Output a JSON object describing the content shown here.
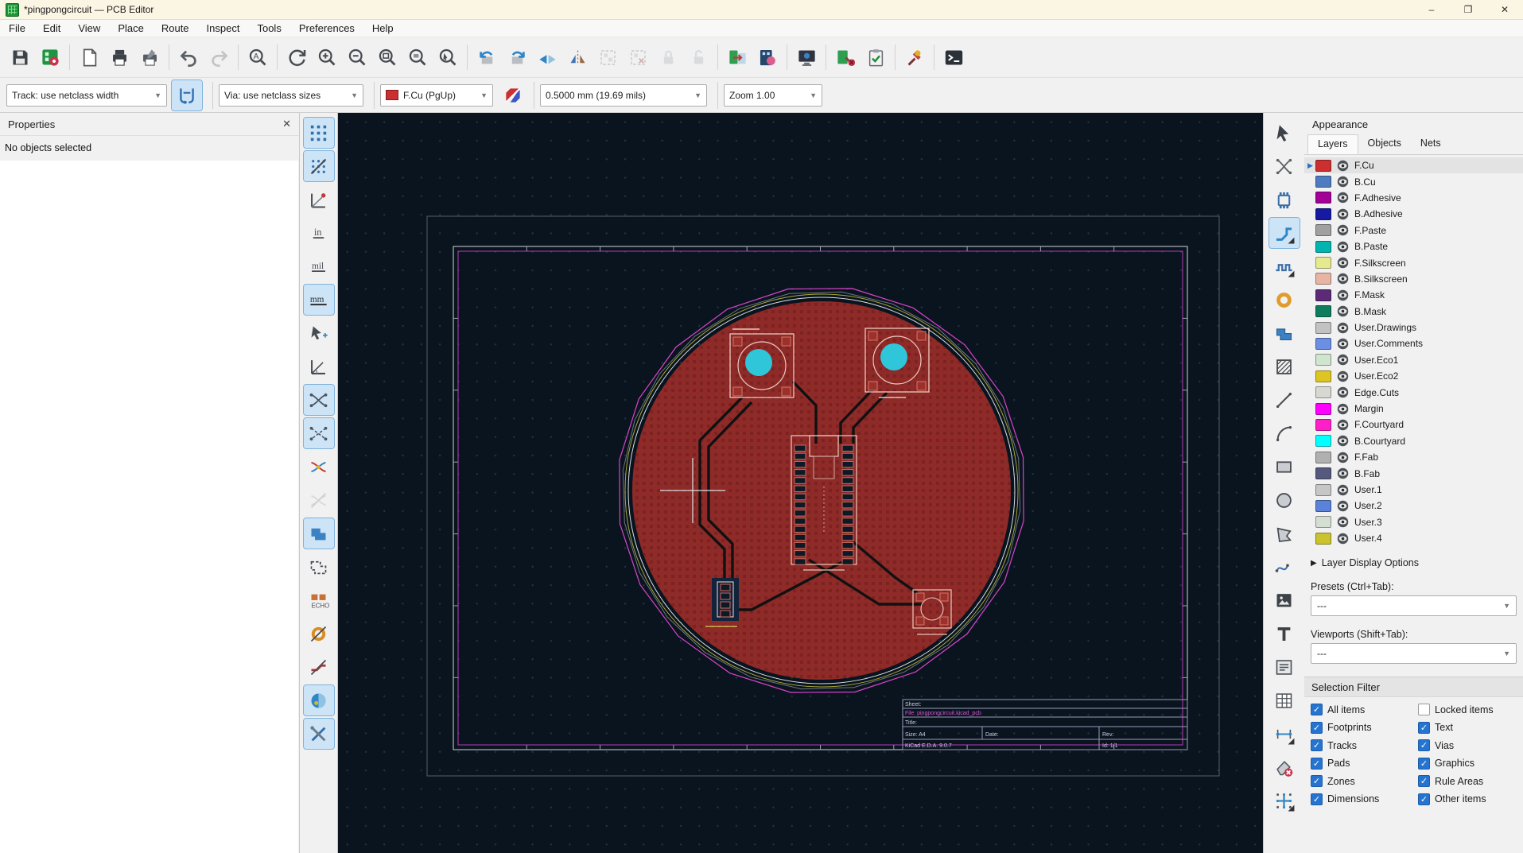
{
  "window": {
    "title": "*pingpongcircuit — PCB Editor",
    "controls": {
      "minimize": "–",
      "maximize": "❐",
      "close": "✕"
    }
  },
  "menu": {
    "items": [
      "File",
      "Edit",
      "View",
      "Place",
      "Route",
      "Inspect",
      "Tools",
      "Preferences",
      "Help"
    ]
  },
  "main_toolbar": [
    "save",
    "board-setup",
    "|",
    "page-settings",
    "print",
    "plot",
    "|",
    "undo",
    "redo:d",
    "|",
    "search",
    "|",
    "refresh-view",
    "zoom-in",
    "zoom-out",
    "zoom-fit-page",
    "zoom-fit-objects",
    "zoom-selection",
    "|",
    "rotate-ccw",
    "rotate-cw",
    "flip-board-view",
    "mirror",
    "group:d",
    "ungroup:d",
    "lock:d",
    "unlock:d",
    "|",
    "update-pcb-from-schematic",
    "footprint-editor",
    "|",
    "show-3d-viewer",
    "|",
    "drc-checker",
    "drc-report",
    "|",
    "plugin-tool",
    "|",
    "scripting-console"
  ],
  "toolbar2": {
    "track_value": "Track: use netclass width",
    "via_value": "Via: use netclass sizes",
    "layer_value": "F.Cu (PgUp)",
    "layer_color": "#cc2f2f",
    "width_value": "0.5000 mm (19.69 mils)",
    "zoom_value": "Zoom 1.00"
  },
  "properties_panel": {
    "title": "Properties",
    "close": "✕",
    "message": "No objects selected"
  },
  "left_toolbar": [
    {
      "n": "grid-show",
      "a": 1
    },
    {
      "n": "grid-override",
      "a": 1
    },
    {
      "n": "polar-coords"
    },
    {
      "n": "units-inches"
    },
    {
      "n": "units-mils"
    },
    {
      "n": "units-mm",
      "a": 1
    },
    {
      "n": "cursor-shape"
    },
    {
      "n": "angle-mode"
    },
    {
      "n": "ratsnest-curved",
      "a": 1
    },
    {
      "n": "ratsnest-lines",
      "a": 1
    },
    {
      "n": "net-colors"
    },
    {
      "n": "hide-ratsnest",
      "d": 1
    },
    {
      "n": "zone-fill",
      "a": 1
    },
    {
      "n": "zone-outline"
    },
    {
      "n": "pad-display"
    },
    {
      "n": "via-display"
    },
    {
      "n": "track-display"
    },
    {
      "n": "high-contrast",
      "a": 1
    },
    {
      "n": "properties-toggle",
      "a": 1
    }
  ],
  "right_toolbar": [
    {
      "n": "select-arrow"
    },
    {
      "n": "local-ratsnest"
    },
    {
      "n": "add-footprint"
    },
    {
      "n": "route-track",
      "a": 1
    },
    {
      "n": "tune-length"
    },
    {
      "n": "add-via"
    },
    {
      "n": "add-zone"
    },
    {
      "n": "rule-area"
    },
    {
      "n": "draw-line"
    },
    {
      "n": "draw-arc"
    },
    {
      "n": "draw-rectangle"
    },
    {
      "n": "draw-circle"
    },
    {
      "n": "draw-polygon"
    },
    {
      "n": "draw-bezier"
    },
    {
      "n": "add-image"
    },
    {
      "n": "add-text"
    },
    {
      "n": "add-textbox"
    },
    {
      "n": "add-table"
    },
    {
      "n": "add-dimension"
    },
    {
      "n": "delete-tool"
    },
    {
      "n": "grid-origin"
    }
  ],
  "appearance": {
    "title": "Appearance",
    "tabs": [
      "Layers",
      "Objects",
      "Nets"
    ],
    "active_tab": "Layers",
    "layers": [
      {
        "name": "F.Cu",
        "color": "#cc2f2f",
        "selected": true
      },
      {
        "name": "B.Cu",
        "color": "#4f7cc0"
      },
      {
        "name": "F.Adhesive",
        "color": "#a20097"
      },
      {
        "name": "B.Adhesive",
        "color": "#151aa0"
      },
      {
        "name": "F.Paste",
        "color": "#a0a0a0"
      },
      {
        "name": "B.Paste",
        "color": "#00b5b0"
      },
      {
        "name": "F.Silkscreen",
        "color": "#e5e98f"
      },
      {
        "name": "B.Silkscreen",
        "color": "#e8b5a5"
      },
      {
        "name": "F.Mask",
        "color": "#5d2a78"
      },
      {
        "name": "B.Mask",
        "color": "#0f7d5d"
      },
      {
        "name": "User.Drawings",
        "color": "#c2c2c2"
      },
      {
        "name": "User.Comments",
        "color": "#6a8fe3"
      },
      {
        "name": "User.Eco1",
        "color": "#cfe5cd"
      },
      {
        "name": "User.Eco2",
        "color": "#ddc622"
      },
      {
        "name": "Edge.Cuts",
        "color": "#d8d8d2"
      },
      {
        "name": "Margin",
        "color": "#ff00ff"
      },
      {
        "name": "F.Courtyard",
        "color": "#ff1fc8"
      },
      {
        "name": "B.Courtyard",
        "color": "#00ffff"
      },
      {
        "name": "F.Fab",
        "color": "#b0b0b0"
      },
      {
        "name": "B.Fab",
        "color": "#55597d"
      },
      {
        "name": "User.1",
        "color": "#c6c6c6"
      },
      {
        "name": "User.2",
        "color": "#5a82d8"
      },
      {
        "name": "User.3",
        "color": "#d4ded2"
      },
      {
        "name": "User.4",
        "color": "#cbc32e"
      }
    ],
    "layer_display_options": "Layer Display Options",
    "presets_label": "Presets (Ctrl+Tab):",
    "presets_value": "---",
    "viewports_label": "Viewports (Shift+Tab):",
    "viewports_value": "---"
  },
  "selection_filter": {
    "title": "Selection Filter",
    "items": [
      {
        "label": "All items",
        "checked": true
      },
      {
        "label": "Locked items",
        "checked": false
      },
      {
        "label": "Footprints",
        "checked": true
      },
      {
        "label": "Text",
        "checked": true
      },
      {
        "label": "Tracks",
        "checked": true
      },
      {
        "label": "Vias",
        "checked": true
      },
      {
        "label": "Pads",
        "checked": true
      },
      {
        "label": "Graphics",
        "checked": true
      },
      {
        "label": "Zones",
        "checked": true
      },
      {
        "label": "Rule Areas",
        "checked": true
      },
      {
        "label": "Dimensions",
        "checked": true
      },
      {
        "label": "Other items",
        "checked": true
      }
    ]
  },
  "canvas": {
    "title_block": {
      "sheet_label": "Sheet:",
      "file": "File: pingpongcircuit.kicad_pcb",
      "title_label": "Title:",
      "size": "Size: A4",
      "date": "Date:",
      "rev": "Rev:",
      "kicad": "KiCad E.D.A. 9.0.7",
      "id": "Id: 1/1"
    }
  }
}
